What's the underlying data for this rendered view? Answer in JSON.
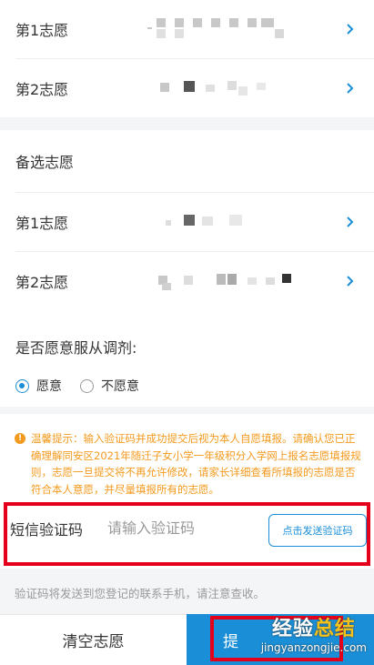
{
  "choices": [
    {
      "label": "第1志愿"
    },
    {
      "label": "第2志愿"
    }
  ],
  "backup": {
    "title": "备选志愿",
    "items": [
      {
        "label": "第1志愿"
      },
      {
        "label": "第2志愿"
      }
    ]
  },
  "adjust": {
    "question": "是否愿意服从调剂:",
    "options": [
      "愿意",
      "不愿意"
    ],
    "selected": "愿意"
  },
  "tip": {
    "text": "温馨提示：输入验证码并成功提交后视为本人自愿填报。请确认您已正确理解同安区2021年随迁子女小学一年级积分入学网上报名志愿填报规则，志愿一旦提交将不再允许修改，请家长详细查看所填报的志愿是否符合本人意愿，并尽量填报所有的志愿。"
  },
  "sms": {
    "label": "短信验证码",
    "placeholder": "请输入验证码",
    "send_button": "点击发送验证码",
    "note": "验证码将发送到您登记的联系手机，请注意查收。"
  },
  "actions": {
    "clear": "清空志愿",
    "submit": "提"
  },
  "watermark": {
    "part1": "经验",
    "part2": "总结",
    "url": "jingyanzongjie.com"
  },
  "colors": {
    "accent": "#1a8fd8",
    "warning": "#f39a1e",
    "highlight": "#e4001b"
  }
}
